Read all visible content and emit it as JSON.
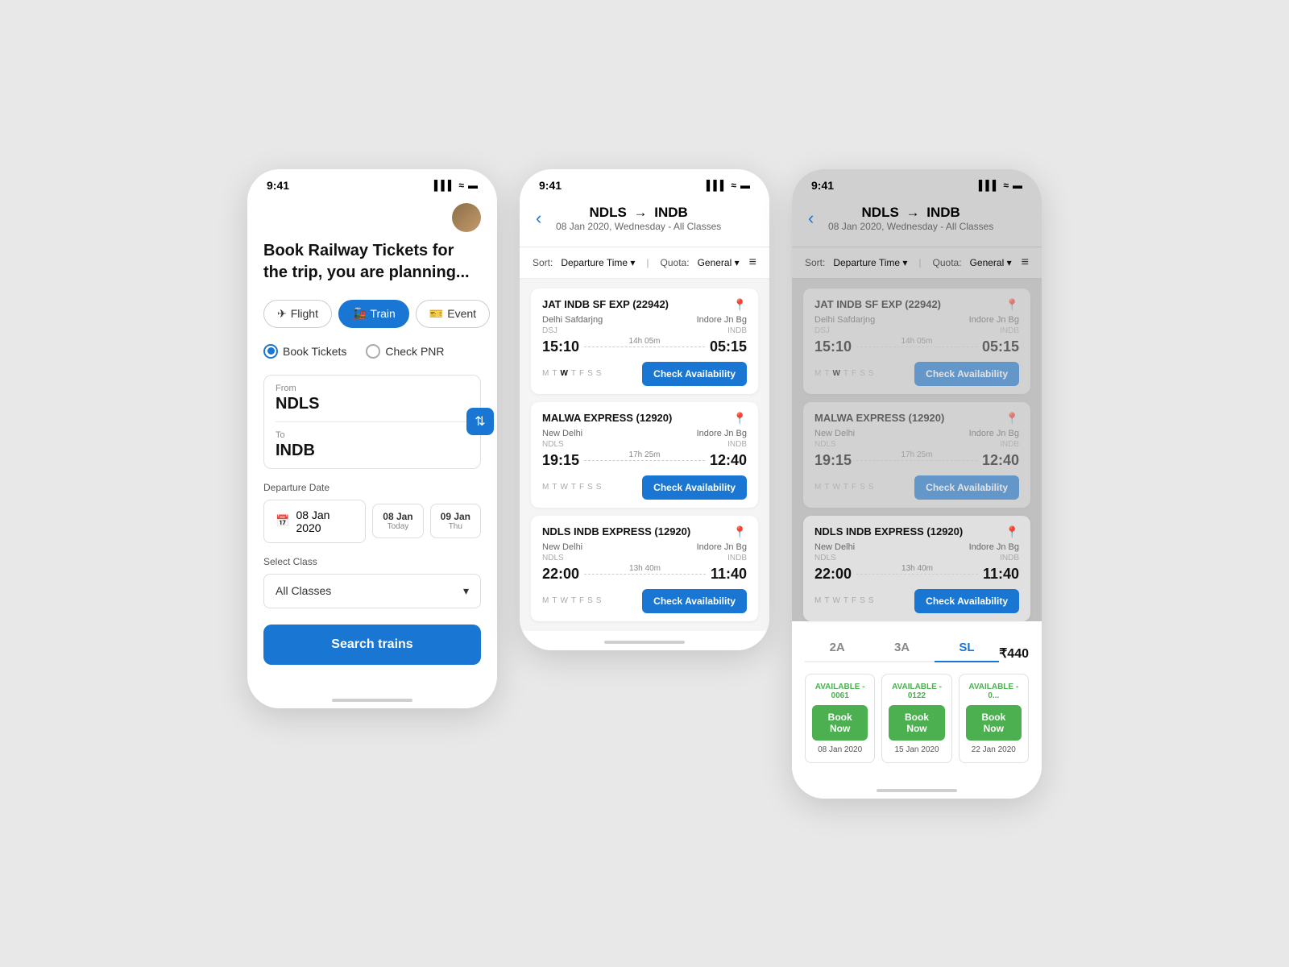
{
  "colors": {
    "primary": "#1976D2",
    "green": "#4CAF50",
    "text": "#111",
    "muted": "#888",
    "border": "#e0e0e0"
  },
  "screen1": {
    "status_time": "9:41",
    "headline": "Book Railway Tickets for the trip, you are planning...",
    "tabs": [
      {
        "id": "flight",
        "label": "Flight",
        "active": false
      },
      {
        "id": "train",
        "label": "Train",
        "active": true
      },
      {
        "id": "event",
        "label": "Event",
        "active": false
      }
    ],
    "radio_options": [
      {
        "id": "book",
        "label": "Book Tickets",
        "checked": true
      },
      {
        "id": "pnr",
        "label": "Check PNR",
        "checked": false
      }
    ],
    "from_label": "From",
    "from_value": "NDLS",
    "to_label": "To",
    "to_value": "INDB",
    "departure_label": "Departure Date",
    "date_main": "08 Jan 2020",
    "date_pills": [
      {
        "day": "08 Jan",
        "sub": "Today"
      },
      {
        "day": "09 Jan",
        "sub": "Thu"
      }
    ],
    "class_label": "Select Class",
    "class_value": "All Classes",
    "search_btn": "Search trains"
  },
  "screen2": {
    "status_time": "9:41",
    "route": "NDLS → INDB",
    "route_detail": "08 Jan 2020,  Wednesday -  All Classes",
    "sort_label": "Sort:",
    "sort_value": "Departure Time",
    "quota_label": "Quota:",
    "quota_value": "General",
    "trains": [
      {
        "name": "JAT INDB SF EXP (22942)",
        "from_name": "Delhi Safdarjng",
        "from_code": "DSJ",
        "to_name": "Indore Jn Bg",
        "to_code": "INDB",
        "depart": "15:10",
        "arrive": "05:15",
        "duration": "14h 05m",
        "days": [
          "M",
          "T",
          "W",
          "T",
          "F",
          "S",
          "S"
        ],
        "active_days": [
          2
        ]
      },
      {
        "name": "MALWA EXPRESS (12920)",
        "from_name": "New Delhi",
        "from_code": "NDLS",
        "to_name": "Indore Jn Bg",
        "to_code": "INDB",
        "depart": "19:15",
        "arrive": "12:40",
        "duration": "17h 25m",
        "days": [
          "M",
          "T",
          "W",
          "T",
          "F",
          "S",
          "S"
        ],
        "active_days": []
      },
      {
        "name": "NDLS INDB EXPRESS (12920)",
        "from_name": "New Delhi",
        "from_code": "NDLS",
        "to_name": "Indore Jn Bg",
        "to_code": "INDB",
        "depart": "22:00",
        "arrive": "11:40",
        "duration": "13h 40m",
        "days": [
          "M",
          "T",
          "W",
          "T",
          "F",
          "S",
          "S"
        ],
        "active_days": []
      }
    ],
    "check_avail_btn": "Check Availability"
  },
  "screen3": {
    "status_time": "9:41",
    "route": "NDLS → INDB",
    "route_detail": "08 Jan 2020,  Wednesday -  All Classes",
    "sort_label": "Sort:",
    "sort_value": "Departure Time",
    "quota_label": "Quota:",
    "quota_value": "General",
    "trains": [
      {
        "name": "JAT INDB SF EXP (22942)",
        "from_name": "Delhi Safdarjng",
        "from_code": "DSJ",
        "to_name": "Indore Jn Bg",
        "to_code": "INDB",
        "depart": "15:10",
        "arrive": "05:15",
        "duration": "14h 05m",
        "days": [
          "M",
          "T",
          "W",
          "T",
          "F",
          "S",
          "S"
        ],
        "active_days": [
          2
        ],
        "selected": false
      },
      {
        "name": "MALWA EXPRESS (12920)",
        "from_name": "New Delhi",
        "from_code": "NDLS",
        "to_name": "Indore Jn Bg",
        "to_code": "INDB",
        "depart": "19:15",
        "arrive": "12:40",
        "duration": "17h 25m",
        "days": [
          "M",
          "T",
          "W",
          "T",
          "F",
          "S",
          "S"
        ],
        "active_days": [],
        "selected": false
      },
      {
        "name": "NDLS INDB EXPRESS (12920)",
        "from_name": "New Delhi",
        "from_code": "NDLS",
        "to_name": "Indore Jn Bg",
        "to_code": "INDB",
        "depart": "22:00",
        "arrive": "11:40",
        "duration": "13h 40m",
        "days": [
          "M",
          "T",
          "W",
          "T",
          "F",
          "S",
          "S"
        ],
        "active_days": [],
        "selected": true
      }
    ],
    "check_avail_btn": "Check Availability",
    "avail_panel": {
      "class_tabs": [
        {
          "label": "2A",
          "active": false
        },
        {
          "label": "3A",
          "active": false
        },
        {
          "label": "SL",
          "active": true
        }
      ],
      "price": "₹440",
      "avail_cards": [
        {
          "status": "AVAILABLE - 0061",
          "btn": "Book Now",
          "date": "08 Jan 2020"
        },
        {
          "status": "AVAILABLE - 0122",
          "btn": "Book Now",
          "date": "15 Jan 2020"
        },
        {
          "status": "AVAILABLE - 0...",
          "btn": "Book Now",
          "date": "22 Jan 2020"
        }
      ]
    }
  }
}
